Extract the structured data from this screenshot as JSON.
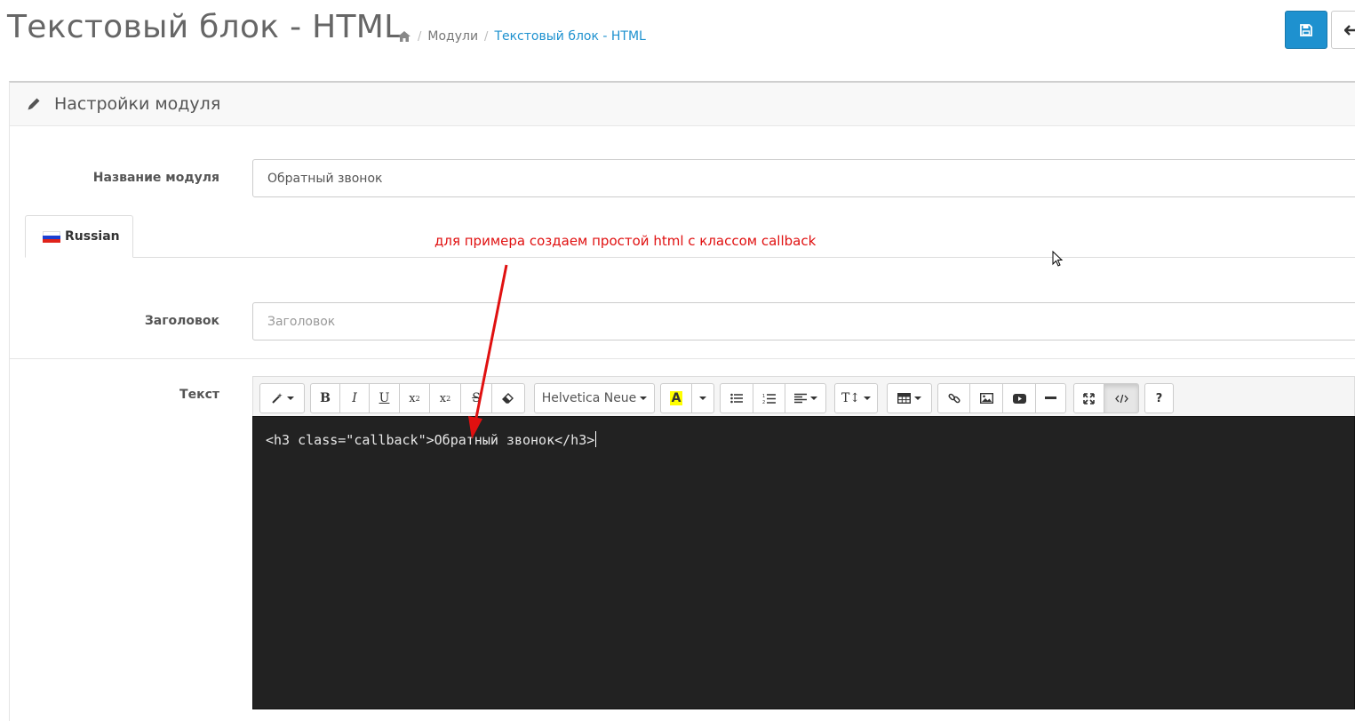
{
  "header": {
    "title": "Текстовый блок - HTML",
    "breadcrumb": [
      "Модули",
      "Текстовый блок - HTML"
    ],
    "save_icon": "floppy-icon",
    "back_icon": "arrow-left-icon"
  },
  "panel": {
    "title": "Настройки модуля",
    "icon": "pencil-icon"
  },
  "form": {
    "module_name_label": "Название модуля",
    "module_name_value": "Обратный звонок",
    "language_tab": "Russian",
    "heading_label": "Заголовок",
    "heading_placeholder": "Заголовок",
    "text_label": "Текст"
  },
  "annotation": "для примера создаем простой html с классом callback",
  "editor": {
    "font_name": "Helvetica Neue",
    "code": "<h3 class=\"callback\">Обратный звонок</h3>",
    "source_mode_active": true
  },
  "colors": {
    "accent": "#1e91cf",
    "annotation": "#e01010",
    "code_bg": "#222222"
  }
}
